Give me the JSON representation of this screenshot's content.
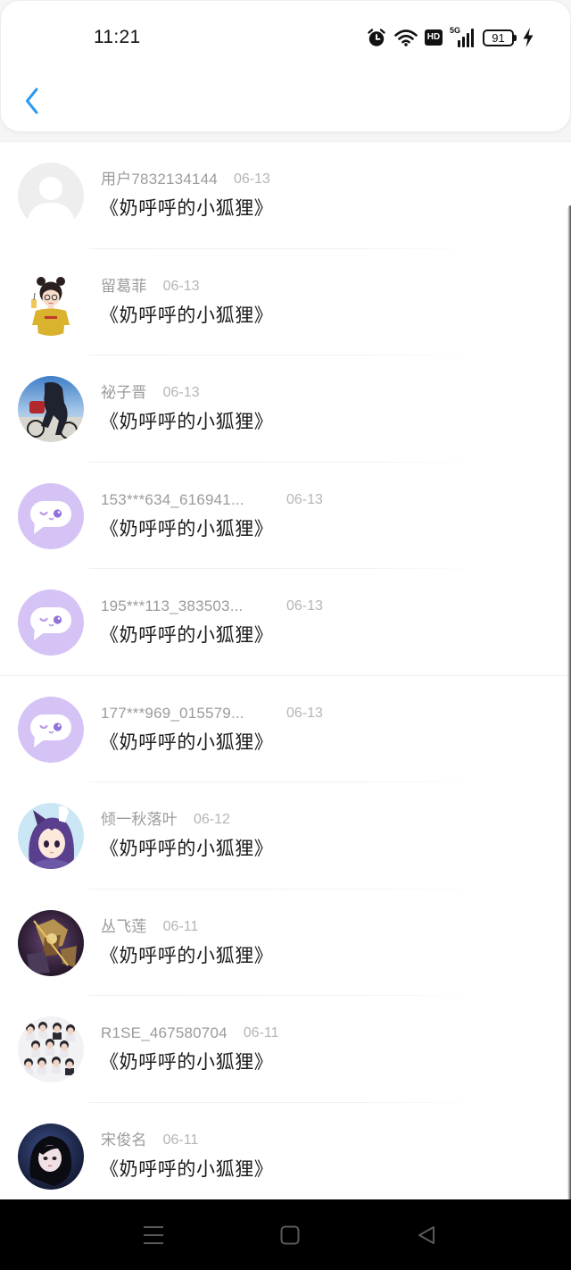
{
  "status_bar": {
    "time": "11:21",
    "hd_label": "HD",
    "network_label": "5G",
    "battery_level": "91",
    "icons": [
      "alarm-icon",
      "wifi-icon",
      "hd-icon",
      "5g-signal-icon",
      "battery-icon",
      "charging-icon"
    ]
  },
  "header": {
    "back_icon": "chevron-left-icon"
  },
  "colors": {
    "accent": "#2b9af3",
    "name_text": "#9b9b9b",
    "date_text": "#b5b5b5",
    "title_text": "#1b1b1b",
    "nav_bar": "#000000",
    "avatar_purple": "#d6c3f6"
  },
  "comments": [
    {
      "user": "用户7832134144",
      "date": "06-13",
      "text": "《奶呼呼的小狐狸》",
      "avatar": "default-avatar"
    },
    {
      "user": "留葛菲",
      "date": "06-13",
      "text": "《奶呼呼的小狐狸》",
      "avatar": "cartoon-girl-avatar"
    },
    {
      "user": "祕子晋",
      "date": "06-13",
      "text": "《奶呼呼的小狐狸》",
      "avatar": "cyclist-photo-avatar"
    },
    {
      "user": "153***634_616941...",
      "date": "06-13",
      "text": "《奶呼呼的小狐狸》",
      "avatar": "chat-bubble-avatar"
    },
    {
      "user": "195***113_383503...",
      "date": "06-13",
      "text": "《奶呼呼的小狐狸》",
      "avatar": "chat-bubble-avatar"
    },
    {
      "user": "177***969_015579...",
      "date": "06-13",
      "text": "《奶呼呼的小狐狸》",
      "avatar": "chat-bubble-avatar"
    },
    {
      "user": "倾一秋落叶",
      "date": "06-12",
      "text": "《奶呼呼的小狐狸》",
      "avatar": "anime-girl-avatar"
    },
    {
      "user": "丛飞莲",
      "date": "06-11",
      "text": "《奶呼呼的小狐狸》",
      "avatar": "game-art-avatar"
    },
    {
      "user": "R1SE_467580704",
      "date": "06-11",
      "text": "《奶呼呼的小狐狸》",
      "avatar": "group-photo-avatar"
    },
    {
      "user": "宋俊名",
      "date": "06-11",
      "text": "《奶呼呼的小狐狸》",
      "avatar": "dark-portrait-avatar"
    }
  ],
  "nav_bar": {
    "icons": [
      "menu-icon",
      "home-icon",
      "back-icon"
    ]
  }
}
